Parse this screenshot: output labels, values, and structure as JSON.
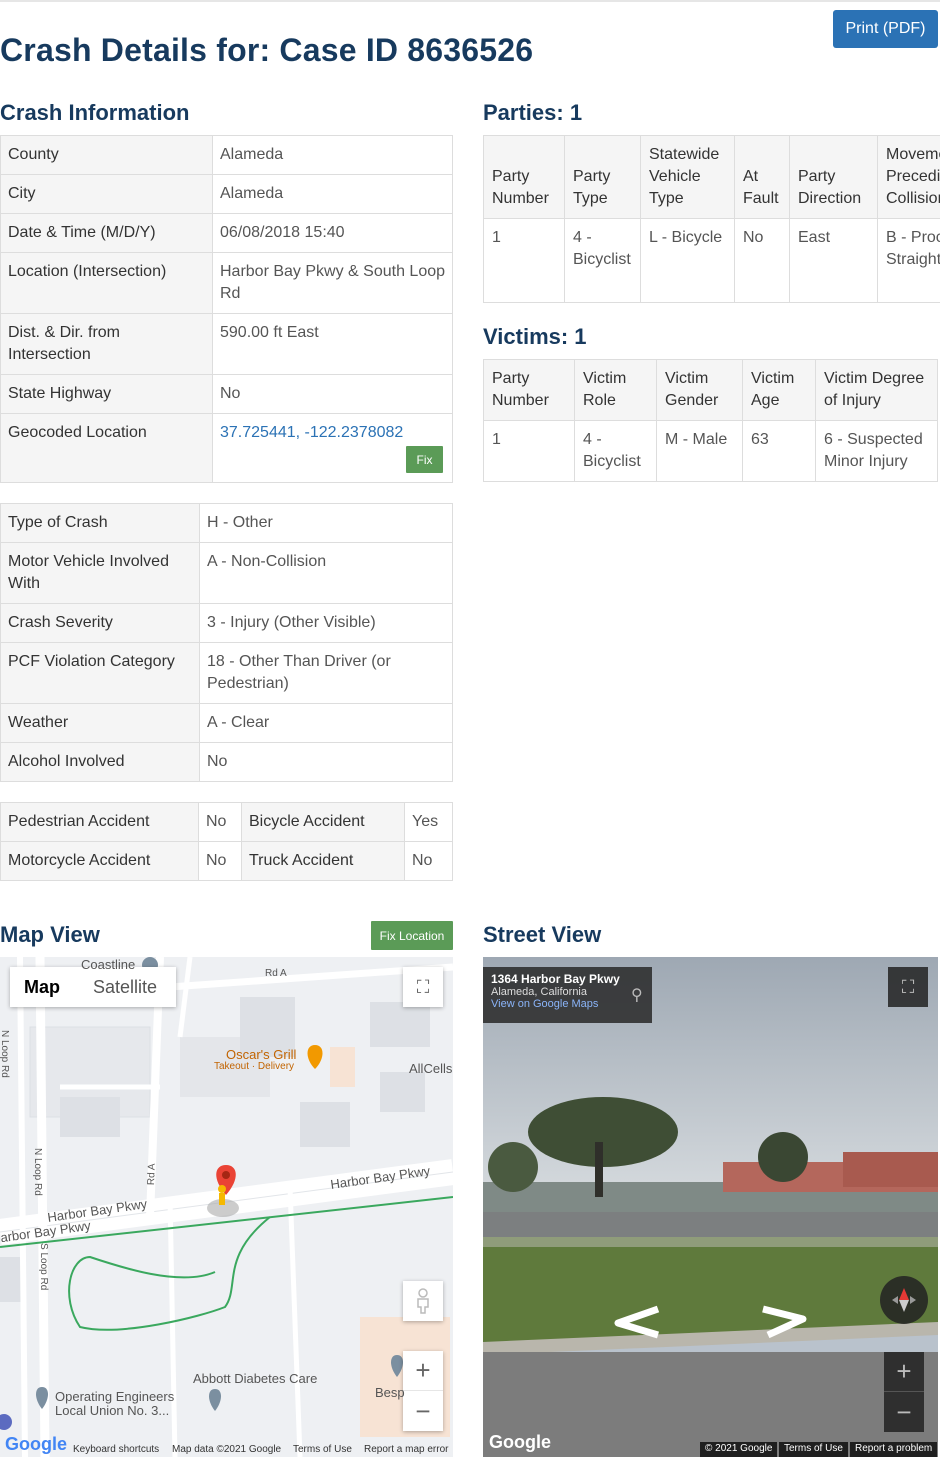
{
  "header": {
    "title": "Crash Details for: Case ID 8636526",
    "print_label": "Print (PDF)"
  },
  "crash_info": {
    "heading": "Crash Information",
    "rows": [
      {
        "label": "County",
        "value": "Alameda"
      },
      {
        "label": "City",
        "value": "Alameda"
      },
      {
        "label": "Date & Time (M/D/Y)",
        "value": "06/08/2018 15:40"
      },
      {
        "label": "Location (Intersection)",
        "value": "Harbor Bay Pkwy & South Loop Rd"
      },
      {
        "label": "Dist. & Dir. from Intersection",
        "value": "590.00 ft East"
      },
      {
        "label": "State Highway",
        "value": "No"
      },
      {
        "label": "Geocoded Location",
        "value": "37.725441, -122.2378082"
      }
    ],
    "fix_label": "Fix"
  },
  "crash_type": {
    "rows": [
      {
        "label": "Type of Crash",
        "value": "H - Other"
      },
      {
        "label": "Motor Vehicle Involved With",
        "value": "A - Non-Collision"
      },
      {
        "label": "Crash Severity",
        "value": "3 - Injury (Other Visible)"
      },
      {
        "label": "PCF Violation Category",
        "value": "18 - Other Than Driver (or Pedestrian)"
      },
      {
        "label": "Weather",
        "value": "A - Clear"
      },
      {
        "label": "Alcohol Involved",
        "value": "No"
      }
    ]
  },
  "accidents": {
    "pedestrian_label": "Pedestrian Accident",
    "pedestrian_value": "No",
    "bicycle_label": "Bicycle Accident",
    "bicycle_value": "Yes",
    "motorcycle_label": "Motorcycle Accident",
    "motorcycle_value": "No",
    "truck_label": "Truck Accident",
    "truck_value": "No"
  },
  "parties": {
    "heading": "Parties: 1",
    "columns": [
      "Party Number",
      "Party Type",
      "Statewide Vehicle Type",
      "At Fault",
      "Party Direction",
      "Movement Preceding Collision"
    ],
    "rows": [
      [
        "1",
        "4 - Bicyclist",
        "L - Bicycle",
        "No",
        "East",
        "B - Proceeding Straight"
      ]
    ]
  },
  "victims": {
    "heading": "Victims: 1",
    "columns": [
      "Party Number",
      "Victim Role",
      "Victim Gender",
      "Victim Age",
      "Victim Degree of Injury"
    ],
    "rows": [
      [
        "1",
        "4 - Bicyclist",
        "M - Male",
        "63",
        "6 - Suspected Minor Injury"
      ]
    ]
  },
  "map_view": {
    "heading": "Map View",
    "fix_location_label": "Fix Location",
    "tab_map": "Map",
    "tab_satellite": "Satellite",
    "labels": {
      "coastline": "Coastline",
      "rd_a_top": "Rd A",
      "oscars": "Oscar's Grill",
      "oscars_sub": "Takeout · Delivery",
      "allcells": "AllCells",
      "n_loop_rd_1": "N Loop Rd",
      "n_loop_rd_2": "N Loop Rd",
      "rd_a": "Rd A",
      "harbor_bay_1": "Harbor Bay Pkwy",
      "harbor_bay_2": "Harbor Bay Pkwy",
      "harbor_bay_3": "arbor Bay Pkwy",
      "s_loop_rd": "S Loop Rd",
      "abbott": "Abbott Diabetes Care",
      "operating": "Operating Engineers",
      "operating_sub": "Local Union No. 3...",
      "besp": "Besp"
    },
    "footer": {
      "keyboard": "Keyboard shortcuts",
      "mapdata": "Map data ©2021 Google",
      "terms": "Terms of Use",
      "report": "Report a map error"
    },
    "google": "Google"
  },
  "street_view": {
    "heading": "Street View",
    "address": "1364 Harbor Bay Pkwy",
    "city": "Alameda, California",
    "view_link": "View on Google Maps",
    "copyright": "© 2021 Google",
    "terms": "Terms of Use",
    "report": "Report a problem",
    "google": "Google"
  }
}
